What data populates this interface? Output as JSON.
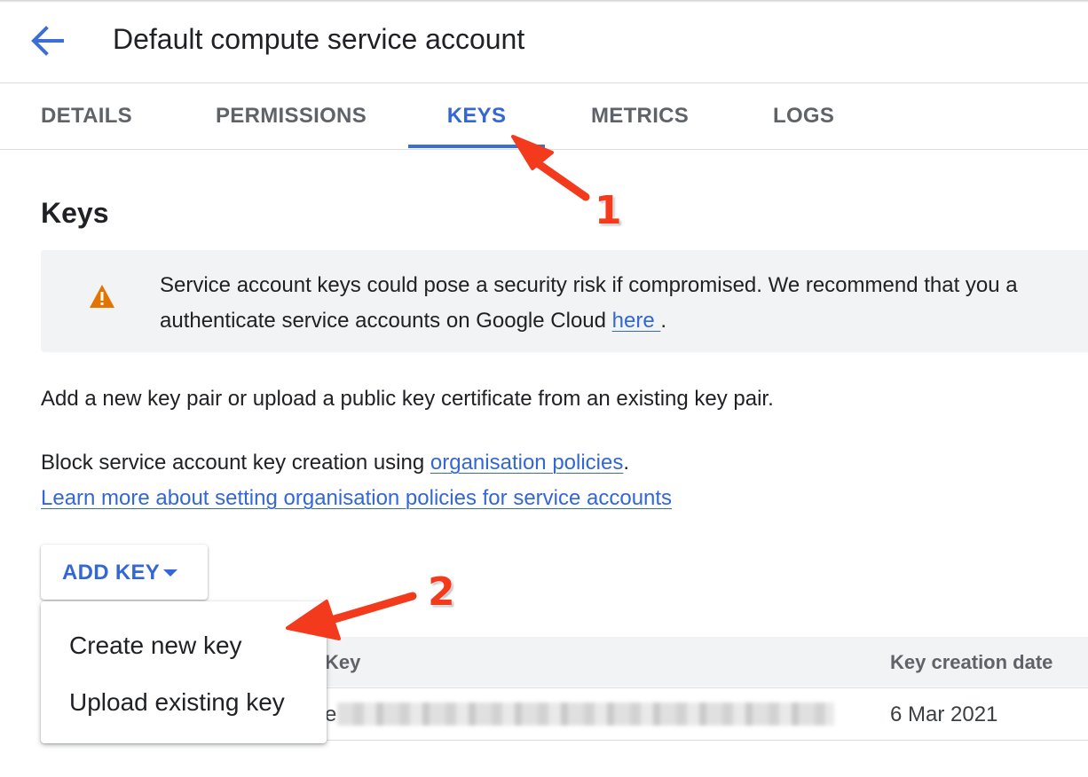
{
  "header": {
    "title": "Default compute service account",
    "back_icon": "arrow-left-icon"
  },
  "tabs": [
    {
      "label": "DETAILS"
    },
    {
      "label": "PERMISSIONS"
    },
    {
      "label": "KEYS",
      "active": true
    },
    {
      "label": "METRICS"
    },
    {
      "label": "LOGS"
    }
  ],
  "keys_section": {
    "title": "Keys",
    "banner": {
      "icon": "warning-icon",
      "line1": "Service account keys could pose a security risk if compromised. We recommend that you a",
      "line2_prefix": "authenticate service accounts on Google Cloud ",
      "link": "here ",
      "line2_suffix": "."
    },
    "description": "Add a new key pair or upload a public key certificate from an existing key pair.",
    "policy_prefix": "Block service account key creation using ",
    "policy_link": "organisation policies",
    "policy_suffix": ".",
    "learn_more_link": "Learn more about setting organisation policies for service accounts"
  },
  "add_key": {
    "label": "ADD KEY",
    "menu": [
      "Create new key",
      "Upload existing key"
    ]
  },
  "table": {
    "columns": [
      "Key",
      "Key creation date"
    ],
    "rows": [
      {
        "key_visible_char": "e",
        "date": "6 Mar 2021"
      }
    ]
  },
  "annotations": [
    "1",
    "2"
  ],
  "colors": {
    "accent": "#3367d6",
    "warning": "#e37400",
    "annotation": "#f43a1c"
  }
}
